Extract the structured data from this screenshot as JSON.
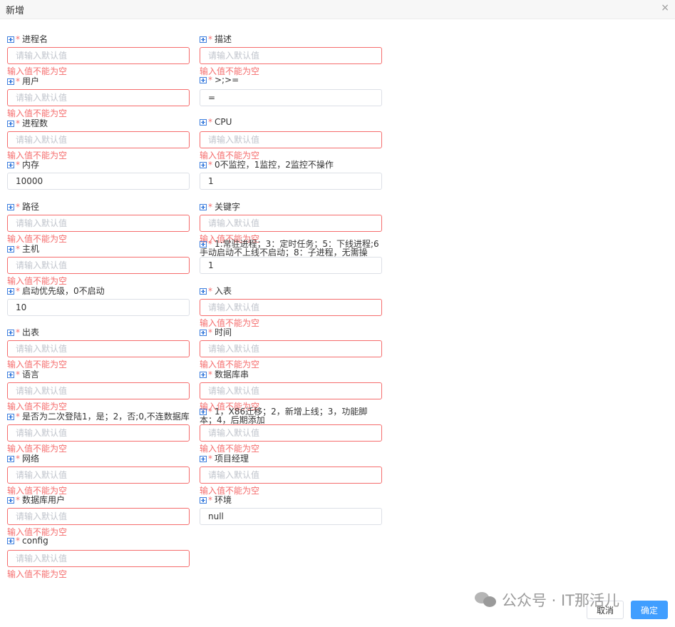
{
  "dialog": {
    "title": "新增",
    "close_glyph": "×"
  },
  "placeholder": "请输入默认值",
  "required_mark": "*",
  "error_text": "输入值不能为空",
  "fields": [
    {
      "label": "进程名",
      "value": "",
      "error": "输入值不能为空"
    },
    {
      "label": "描述",
      "value": "",
      "error": "输入值不能为空"
    },
    {
      "label": "用户",
      "value": "",
      "error": "输入值不能为空"
    },
    {
      "label": ">;>=",
      "value": "=",
      "error": ""
    },
    {
      "label": "进程数",
      "value": "",
      "error": "输入值不能为空"
    },
    {
      "label": "CPU",
      "value": "",
      "error": "输入值不能为空"
    },
    {
      "label": "内存",
      "value": "10000",
      "error": ""
    },
    {
      "label": "0不监控，1监控，2监控不操作",
      "value": "1",
      "error": ""
    },
    {
      "label": "路径",
      "value": "",
      "error": "输入值不能为空"
    },
    {
      "label": "关键字",
      "value": "",
      "error": "输入值不能为空"
    },
    {
      "label": "主机",
      "value": "",
      "error": "输入值不能为空"
    },
    {
      "label": "1:常驻进程；3：定时任务；5：下线进程;6 手动启动不上线不启动；8：子进程，无需操",
      "value": "1",
      "error": ""
    },
    {
      "label": "启动优先级，0不启动",
      "value": "10",
      "error": ""
    },
    {
      "label": "入表",
      "value": "",
      "error": "输入值不能为空"
    },
    {
      "label": "出表",
      "value": "",
      "error": "输入值不能为空"
    },
    {
      "label": "时间",
      "value": "",
      "error": "输入值不能为空"
    },
    {
      "label": "语言",
      "value": "",
      "error": "输入值不能为空"
    },
    {
      "label": "数据库串",
      "value": "",
      "error": "输入值不能为空"
    },
    {
      "label": "是否为二次登陆1，是；2，否;0,不连数据库",
      "value": "",
      "error": "输入值不能为空"
    },
    {
      "label": "1，X86迁移；2，新增上线；3，功能脚本；4，后期添加",
      "value": "",
      "error": "输入值不能为空"
    },
    {
      "label": "网络",
      "value": "",
      "error": "输入值不能为空"
    },
    {
      "label": "项目经理",
      "value": "",
      "error": "输入值不能为空"
    },
    {
      "label": "数据库用户",
      "value": "",
      "error": "输入值不能为空"
    },
    {
      "label": "环境",
      "value": "null",
      "error": ""
    },
    {
      "label": "config",
      "value": "",
      "error": "输入值不能为空"
    }
  ],
  "footer": {
    "cancel_label": "取消",
    "ok_label": "确定"
  },
  "watermark": {
    "text": "公众号 · IT那活儿",
    "icon": "wechat-icon"
  },
  "colors": {
    "error": "#f56c6c",
    "primary": "#409eff",
    "border": "#dcdfe6"
  }
}
